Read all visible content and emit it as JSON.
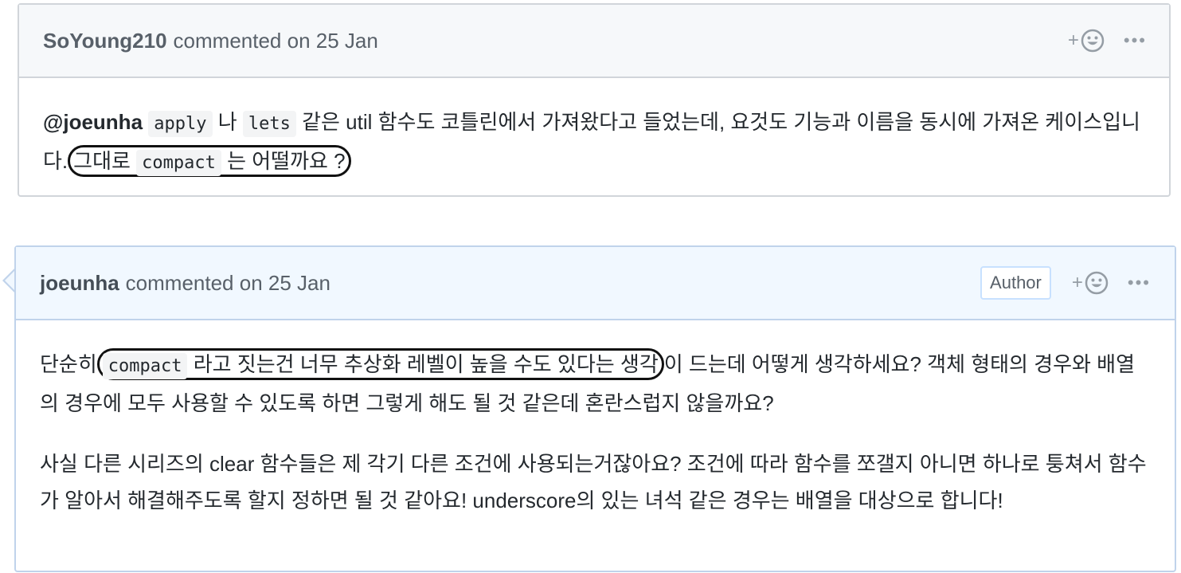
{
  "comments": [
    {
      "author": "SoYoung210",
      "meta": "commented on 25 Jan",
      "react_plus": "+",
      "react_icon": "smiley-icon",
      "menu": "•••",
      "body": {
        "mention": "@joeunha",
        "code_apply": "apply",
        "text_na": "나",
        "code_lets": "lets",
        "text_1": "같은 util 함수도 코틀린에서 가져왔다고 들었는데, 요것도 기능과 이름을 동시에 가져온 케이스입니다.",
        "hl_text_1": "그대로",
        "code_compact": "compact",
        "hl_text_2": "는 어떨까요 ?"
      }
    },
    {
      "author": "joeunha",
      "meta": "commented on 25 Jan",
      "badge": "Author",
      "react_plus": "+",
      "react_icon": "smiley-icon",
      "menu": "•••",
      "body": {
        "p1_start": "단순히",
        "code_compact": "compact",
        "p1_hl": "라고 짓는건 너무 추상화 레벨이 높을 수도 있다는 생각",
        "p1_rest": "이 드는데 어떻게 생각하세요? 객체 형태의 경우와 배열의 경우에 모두 사용할 수 있도록 하면 그렇게 해도 될 것 같은데 혼란스럽지 않을까요?",
        "p2": "사실 다른 시리즈의 clear 함수들은 제 각기 다른 조건에 사용되는거잖아요? 조건에 따라 함수를 쪼갤지 아니면 하나로 퉁쳐서 함수가 알아서 해결해주도록 할지 정하면 될 것 같아요! underscore의 있는 녀석 같은 경우는 배열을 대상으로 합니다!"
      }
    }
  ],
  "colors": {
    "header_bg": "#f6f8fa",
    "own_header_bg": "#f1f8ff",
    "border": "#d1d5da",
    "own_border": "#c0d3eb",
    "highlight_ring": "#111111"
  }
}
